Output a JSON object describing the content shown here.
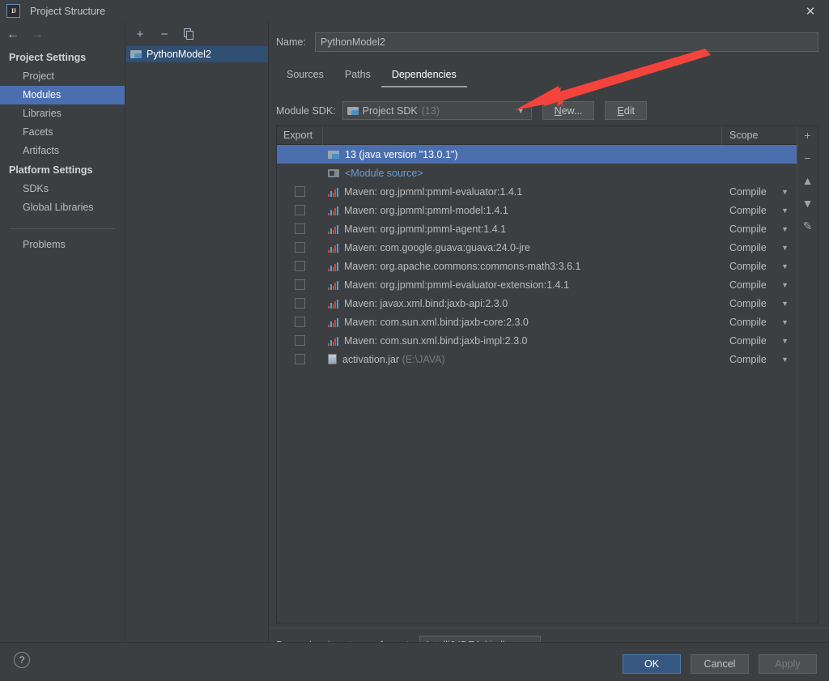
{
  "window": {
    "title": "Project Structure",
    "app_icon": "IJ",
    "close_label": "✕"
  },
  "nav": {
    "back_icon": "←",
    "forward_icon": "→",
    "groups": [
      {
        "label": "Project Settings",
        "items": [
          {
            "label": "Project",
            "selected": false
          },
          {
            "label": "Modules",
            "selected": true
          },
          {
            "label": "Libraries",
            "selected": false
          },
          {
            "label": "Facets",
            "selected": false
          },
          {
            "label": "Artifacts",
            "selected": false
          }
        ]
      },
      {
        "label": "Platform Settings",
        "items": [
          {
            "label": "SDKs",
            "selected": false
          },
          {
            "label": "Global Libraries",
            "selected": false
          }
        ]
      }
    ],
    "problems_label": "Problems"
  },
  "modules_panel": {
    "toolbar": [
      {
        "name": "add-module-button",
        "glyph": "+"
      },
      {
        "name": "remove-module-button",
        "glyph": "−"
      },
      {
        "name": "copy-module-button",
        "glyph": "❐"
      }
    ],
    "items": [
      {
        "label": "PythonModel2",
        "selected": true,
        "icon": "module-icon"
      }
    ]
  },
  "module": {
    "name_label": "Name:",
    "name_value": "PythonModel2",
    "tabs": [
      {
        "label": "Sources",
        "active": false
      },
      {
        "label": "Paths",
        "active": false
      },
      {
        "label": "Dependencies",
        "active": true
      }
    ],
    "sdk_label": "Module SDK:",
    "sdk_value": "Project SDK",
    "sdk_version": "(13)",
    "sdk_caret": "▼",
    "new_button": "New...",
    "edit_button": "Edit"
  },
  "dependencies_table": {
    "columns": {
      "export": "Export",
      "scope": "Scope"
    },
    "rows": [
      {
        "checkbox": null,
        "icon": "jdk-icon",
        "label": "13 (java version \"13.0.1\")",
        "scope": null,
        "selected": true
      },
      {
        "checkbox": null,
        "icon": "source-icon",
        "label": "<Module source>",
        "scope": null,
        "selected": false,
        "link": true
      },
      {
        "checkbox": false,
        "icon": "maven-icon",
        "label": "Maven: org.jpmml:pmml-evaluator:1.4.1",
        "scope": "Compile",
        "selected": false
      },
      {
        "checkbox": false,
        "icon": "maven-icon",
        "label": "Maven: org.jpmml:pmml-model:1.4.1",
        "scope": "Compile",
        "selected": false
      },
      {
        "checkbox": false,
        "icon": "maven-icon",
        "label": "Maven: org.jpmml:pmml-agent:1.4.1",
        "scope": "Compile",
        "selected": false
      },
      {
        "checkbox": false,
        "icon": "maven-icon",
        "label": "Maven: com.google.guava:guava:24.0-jre",
        "scope": "Compile",
        "selected": false
      },
      {
        "checkbox": false,
        "icon": "maven-icon",
        "label": "Maven: org.apache.commons:commons-math3:3.6.1",
        "scope": "Compile",
        "selected": false
      },
      {
        "checkbox": false,
        "icon": "maven-icon",
        "label": "Maven: org.jpmml:pmml-evaluator-extension:1.4.1",
        "scope": "Compile",
        "selected": false
      },
      {
        "checkbox": false,
        "icon": "maven-icon",
        "label": "Maven: javax.xml.bind:jaxb-api:2.3.0",
        "scope": "Compile",
        "selected": false
      },
      {
        "checkbox": false,
        "icon": "maven-icon",
        "label": "Maven: com.sun.xml.bind:jaxb-core:2.3.0",
        "scope": "Compile",
        "selected": false
      },
      {
        "checkbox": false,
        "icon": "maven-icon",
        "label": "Maven: com.sun.xml.bind:jaxb-impl:2.3.0",
        "scope": "Compile",
        "selected": false
      },
      {
        "checkbox": false,
        "icon": "jar-icon",
        "label": "activation.jar",
        "path": "(E:\\JAVA)",
        "scope": "Compile",
        "selected": false
      }
    ],
    "scope_caret": "▼",
    "toolbar": [
      {
        "name": "add-dependency-button",
        "glyph": "+"
      },
      {
        "name": "remove-dependency-button",
        "glyph": "−"
      },
      {
        "name": "move-up-button",
        "glyph": "▲"
      },
      {
        "name": "move-down-button",
        "glyph": "▼"
      },
      {
        "name": "edit-dependency-button",
        "glyph": "✎"
      }
    ]
  },
  "storage": {
    "label": "Dependencies storage format:",
    "value": "IntelliJ IDEA (.iml)",
    "caret": "▼"
  },
  "footer": {
    "help_label": "?",
    "ok": "OK",
    "cancel": "Cancel",
    "apply": "Apply"
  },
  "colors": {
    "background": "#3c3f41",
    "selection_blue": "#4b6eaf",
    "module_selection": "#2f4f73",
    "primary_button": "#365880",
    "annotation_red": "#f4433c",
    "link_blue": "#6a9fd4"
  }
}
